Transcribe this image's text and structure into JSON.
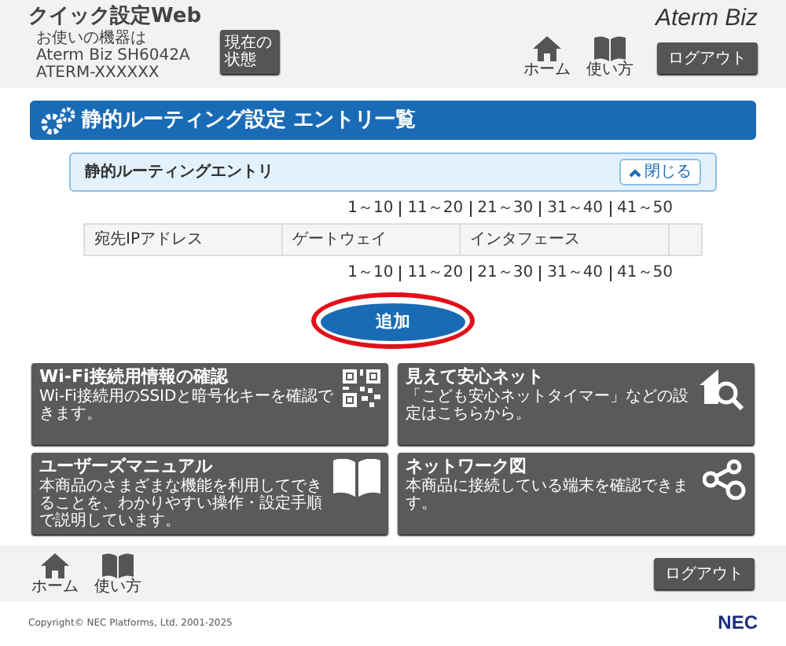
{
  "header": {
    "title": "クイック設定Web",
    "device_lines": [
      "お使いの機器は",
      "Aterm Biz SH6042A",
      "ATERM-XXXXXX"
    ],
    "status_button": "現在の状態",
    "nav": [
      {
        "kind": "home",
        "label": "ホーム"
      },
      {
        "kind": "book",
        "label": "使い方"
      }
    ],
    "logout": "ログアウト",
    "brand": "Aterm Biz"
  },
  "page_title": "静的ルーティング設定 エントリ一覧",
  "section": {
    "title": "静的ルーティングエントリ",
    "expanded": true,
    "toggle": "閉じる"
  },
  "pagination_top": [
    "1～10",
    "11～20",
    "21～30",
    "31～40",
    "41～50"
  ],
  "table": {
    "columns": [
      "宛先IPアドレス",
      "ゲートウェイ",
      "インタフェース"
    ]
  },
  "pagination_bottom": [
    "1～10",
    "11～20",
    "21～30",
    "31～40",
    "41～50"
  ],
  "add_button": {
    "label": "追加",
    "highlighted": true
  },
  "tiles": [
    {
      "kind": "qr",
      "title": "Wi-Fi接続用情報の確認",
      "description": "Wi-Fi接続用のSSIDと暗号化キーを確認できます。"
    },
    {
      "kind": "house-search",
      "title": "見えて安心ネット",
      "description": "「こども安心ネットタイマー」などの設定はこちらから。"
    },
    {
      "kind": "book",
      "title": "ユーザーズマニュアル",
      "description": "本商品のさまざまな機能を利用してできることを、わかりやすい操作・設定手順で説明しています。"
    },
    {
      "kind": "network",
      "title": "ネットワーク図",
      "description": "本商品に接続している端末を確認できます。"
    }
  ],
  "footer": {
    "nav": [
      {
        "kind": "home",
        "label": "ホーム"
      },
      {
        "kind": "book",
        "label": "使い方"
      }
    ],
    "logout": "ログアウト",
    "copyright": "Copyright© NEC Platforms, Ltd. 2001-2025",
    "logo": "NEC"
  }
}
